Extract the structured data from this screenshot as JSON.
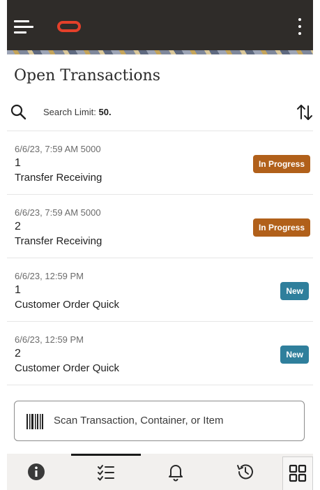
{
  "header": {
    "menu_icon": "hamburger-menu-icon",
    "logo": "oracle-logo",
    "more_icon": "vertical-ellipsis-icon",
    "logo_color": "#e4402a",
    "bar_color": "#2f2c29"
  },
  "page": {
    "title": "Open Transactions"
  },
  "search": {
    "icon": "search-icon",
    "limit_label": "Search Limit:",
    "limit_value": "50.",
    "sort_icon": "sort-icon"
  },
  "transactions": [
    {
      "timestamp": "6/6/23, 7:59 AM 5000",
      "number": "1",
      "type": "Transfer Receiving",
      "status": "In Progress",
      "status_color": "#b1601a"
    },
    {
      "timestamp": "6/6/23, 7:59 AM 5000",
      "number": "2",
      "type": "Transfer Receiving",
      "status": "In Progress",
      "status_color": "#b1601a"
    },
    {
      "timestamp": "6/6/23, 12:59 PM",
      "number": "1",
      "type": "Customer Order Quick",
      "status": "New",
      "status_color": "#2f7f9c"
    },
    {
      "timestamp": "6/6/23, 12:59 PM",
      "number": "2",
      "type": "Customer Order Quick",
      "status": "New",
      "status_color": "#2f7f9c"
    }
  ],
  "scan": {
    "icon": "barcode-icon",
    "placeholder": "Scan Transaction, Container, or Item"
  },
  "bottom_nav": {
    "items": [
      {
        "icon": "info-icon",
        "active": false
      },
      {
        "icon": "task-list-icon",
        "active": true
      },
      {
        "icon": "bell-icon",
        "active": false
      },
      {
        "icon": "history-icon",
        "active": false
      },
      {
        "icon": "grid-icon",
        "active": false
      }
    ]
  }
}
